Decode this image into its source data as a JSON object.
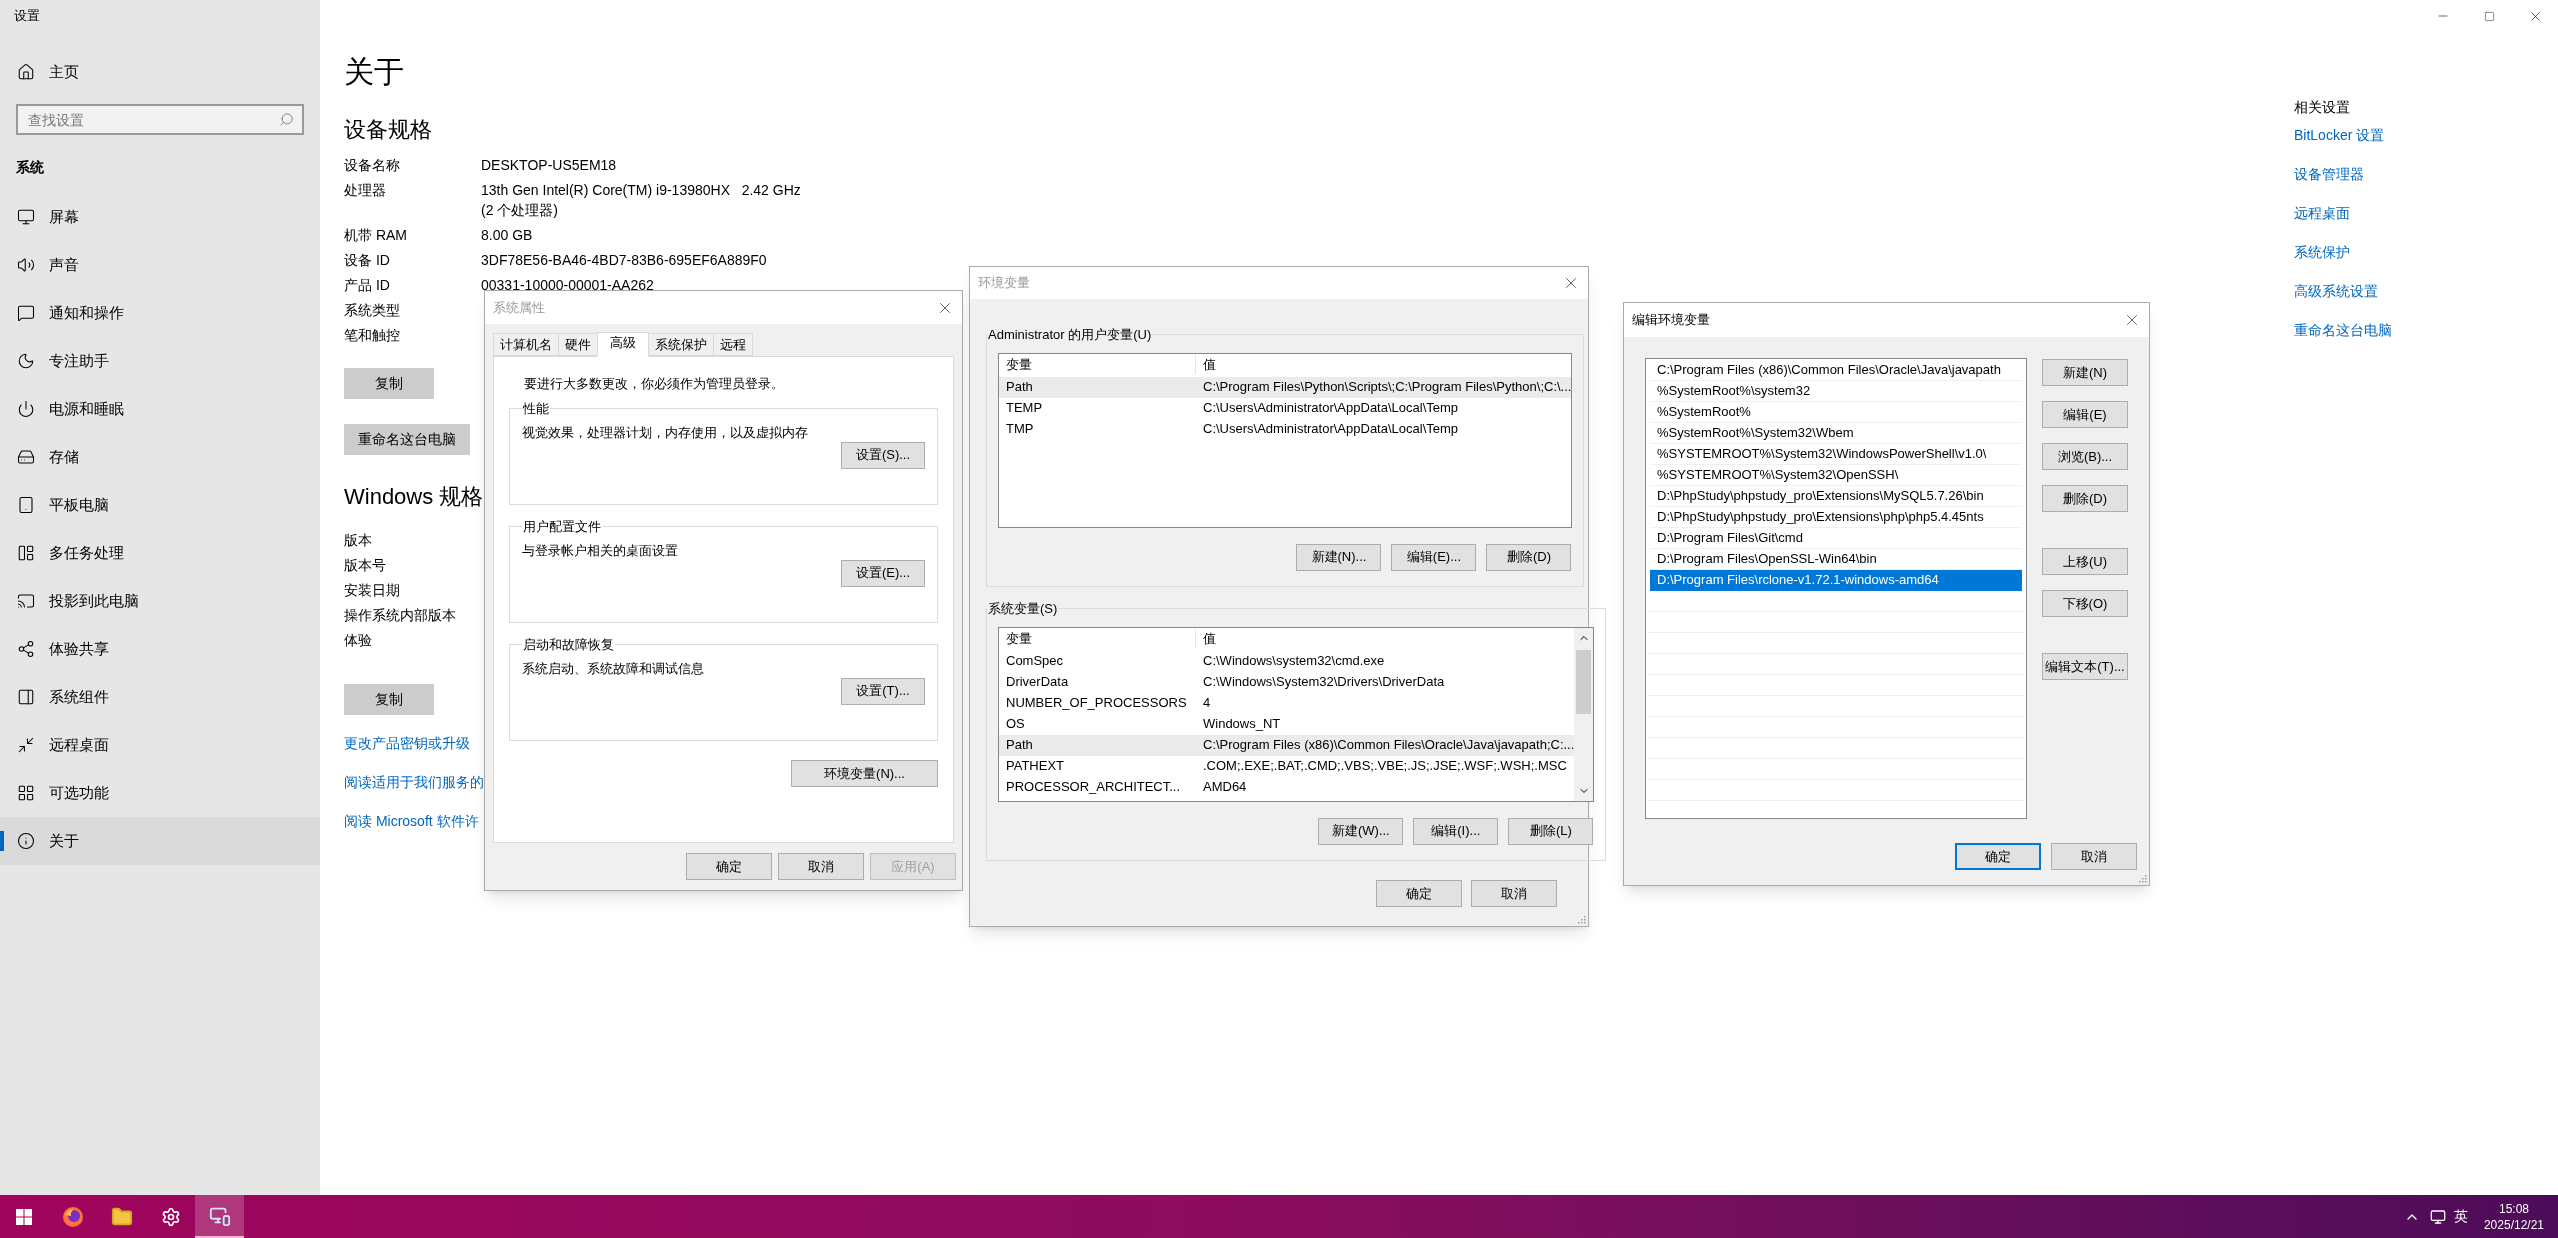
{
  "settings": {
    "title": "设置",
    "home": "主页",
    "search": {
      "placeholder": "查找设置"
    },
    "section": "系统",
    "items": [
      {
        "label": "屏幕",
        "selected": false
      },
      {
        "label": "声音",
        "selected": false
      },
      {
        "label": "通知和操作",
        "selected": false
      },
      {
        "label": "专注助手",
        "selected": false
      },
      {
        "label": "电源和睡眠",
        "selected": false
      },
      {
        "label": "存储",
        "selected": false
      },
      {
        "label": "平板电脑",
        "selected": false
      },
      {
        "label": "多任务处理",
        "selected": false
      },
      {
        "label": "投影到此电脑",
        "selected": false
      },
      {
        "label": "体验共享",
        "selected": false
      },
      {
        "label": "系统组件",
        "selected": false
      },
      {
        "label": "远程桌面",
        "selected": false
      },
      {
        "label": "可选功能",
        "selected": false
      },
      {
        "label": "关于",
        "selected": true
      }
    ],
    "page_title": "关于",
    "device_specs": {
      "heading": "设备规格",
      "rows": [
        {
          "label": "设备名称",
          "value": [
            "DESKTOP-US5EM18"
          ]
        },
        {
          "label": "处理器",
          "value": [
            "13th Gen Intel(R) Core(TM) i9-13980HX   2.42 GHz",
            "(2 个处理器)"
          ]
        },
        {
          "label": "机带 RAM",
          "value": [
            "8.00 GB"
          ]
        },
        {
          "label": "设备 ID",
          "value": [
            "3DF78E56-BA46-4BD7-83B6-695EF6A889F0"
          ]
        },
        {
          "label": "产品 ID",
          "value": [
            "00331-10000-00001-AA262"
          ]
        },
        {
          "label": "系统类型",
          "value": []
        },
        {
          "label": "笔和触控",
          "value": []
        }
      ],
      "copy_button": "复制",
      "rename_button": "重命名这台电脑"
    },
    "windows_specs": {
      "heading": "Windows 规格",
      "rows": [
        {
          "label": "版本"
        },
        {
          "label": "版本号"
        },
        {
          "label": "安装日期"
        },
        {
          "label": "操作系统内部版本"
        },
        {
          "label": "体验"
        }
      ],
      "copy_button": "复制"
    },
    "links": [
      "更改产品密钥或升级",
      "阅读适用于我们服务的",
      "阅读 Microsoft 软件许"
    ],
    "related": {
      "heading": "相关设置",
      "links": [
        "BitLocker 设置",
        "设备管理器",
        "远程桌面",
        "系统保护",
        "高级系统设置",
        "重命名这台电脑"
      ]
    }
  },
  "system_properties": {
    "title": "系统属性",
    "active": false,
    "tabs": [
      {
        "label": "计算机名",
        "selected": false
      },
      {
        "label": "硬件",
        "selected": false
      },
      {
        "label": "高级",
        "selected": true
      },
      {
        "label": "系统保护",
        "selected": false
      },
      {
        "label": "远程",
        "selected": false
      }
    ],
    "notice": "要进行大多数更改，你必须作为管理员登录。",
    "groups": [
      {
        "title": "性能",
        "description": "视觉效果，处理器计划，内存使用，以及虚拟内存",
        "button": "设置(S)..."
      },
      {
        "title": "用户配置文件",
        "description": "与登录帐户相关的桌面设置",
        "button": "设置(E)..."
      },
      {
        "title": "启动和故障恢复",
        "description": "系统启动、系统故障和调试信息",
        "button": "设置(T)..."
      }
    ],
    "env_button": "环境变量(N)...",
    "buttons": [
      {
        "label": "确定",
        "disabled": false
      },
      {
        "label": "取消",
        "disabled": false
      },
      {
        "label": "应用(A)",
        "disabled": true
      }
    ]
  },
  "environment_variables": {
    "title": "环境变量",
    "active": false,
    "user_vars": {
      "title": "Administrator 的用户变量(U)",
      "columns": [
        "变量",
        "值"
      ],
      "rows": [
        {
          "name": "Path",
          "value": "C:\\Program Files\\Python\\Scripts\\;C:\\Program Files\\Python\\;C:\\...",
          "selected": true
        },
        {
          "name": "TEMP",
          "value": "C:\\Users\\Administrator\\AppData\\Local\\Temp",
          "selected": false
        },
        {
          "name": "TMP",
          "value": "C:\\Users\\Administrator\\AppData\\Local\\Temp",
          "selected": false
        }
      ],
      "buttons": [
        "新建(N)...",
        "编辑(E)...",
        "删除(D)"
      ]
    },
    "system_vars": {
      "title": "系统变量(S)",
      "columns": [
        "变量",
        "值"
      ],
      "rows": [
        {
          "name": "ComSpec",
          "value": "C:\\Windows\\system32\\cmd.exe",
          "selected": false
        },
        {
          "name": "DriverData",
          "value": "C:\\Windows\\System32\\Drivers\\DriverData",
          "selected": false
        },
        {
          "name": "NUMBER_OF_PROCESSORS",
          "value": "4",
          "selected": false
        },
        {
          "name": "OS",
          "value": "Windows_NT",
          "selected": false
        },
        {
          "name": "Path",
          "value": "C:\\Program Files (x86)\\Common Files\\Oracle\\Java\\javapath;C:...",
          "selected": true
        },
        {
          "name": "PATHEXT",
          "value": ".COM;.EXE;.BAT;.CMD;.VBS;.VBE;.JS;.JSE;.WSF;.WSH;.MSC",
          "selected": false
        },
        {
          "name": "PROCESSOR_ARCHITECT...",
          "value": "AMD64",
          "selected": false
        }
      ],
      "buttons": [
        "新建(W)...",
        "编辑(I)...",
        "删除(L)"
      ]
    },
    "buttons": [
      "确定",
      "取消"
    ]
  },
  "edit_variable": {
    "title": "编辑环境变量",
    "active": true,
    "entries": [
      {
        "text": "C:\\Program Files (x86)\\Common Files\\Oracle\\Java\\javapath",
        "selected": false
      },
      {
        "text": "%SystemRoot%\\system32",
        "selected": false
      },
      {
        "text": "%SystemRoot%",
        "selected": false
      },
      {
        "text": "%SystemRoot%\\System32\\Wbem",
        "selected": false
      },
      {
        "text": "%SYSTEMROOT%\\System32\\WindowsPowerShell\\v1.0\\",
        "selected": false
      },
      {
        "text": "%SYSTEMROOT%\\System32\\OpenSSH\\",
        "selected": false
      },
      {
        "text": "D:\\PhpStudy\\phpstudy_pro\\Extensions\\MySQL5.7.26\\bin",
        "selected": false
      },
      {
        "text": "D:\\PhpStudy\\phpstudy_pro\\Extensions\\php\\php5.4.45nts",
        "selected": false
      },
      {
        "text": "D:\\Program Files\\Git\\cmd",
        "selected": false
      },
      {
        "text": "D:\\Program Files\\OpenSSL-Win64\\bin",
        "selected": false
      },
      {
        "text": "D:\\Program Files\\rclone-v1.72.1-windows-amd64",
        "selected": true
      }
    ],
    "side_buttons": [
      [
        "新建(N)",
        "编辑(E)",
        "浏览(B)...",
        "删除(D)"
      ],
      [
        "上移(U)",
        "下移(O)"
      ],
      [
        "编辑文本(T)..."
      ]
    ],
    "buttons": [
      {
        "label": "确定",
        "default": true
      },
      {
        "label": "取消",
        "default": false
      }
    ]
  },
  "taskbar": {
    "apps": [
      {
        "active": false
      },
      {
        "active": false
      },
      {
        "active": false
      },
      {
        "active": true
      }
    ],
    "ime": "英",
    "time": "15:08",
    "date": "2025/12/21"
  }
}
